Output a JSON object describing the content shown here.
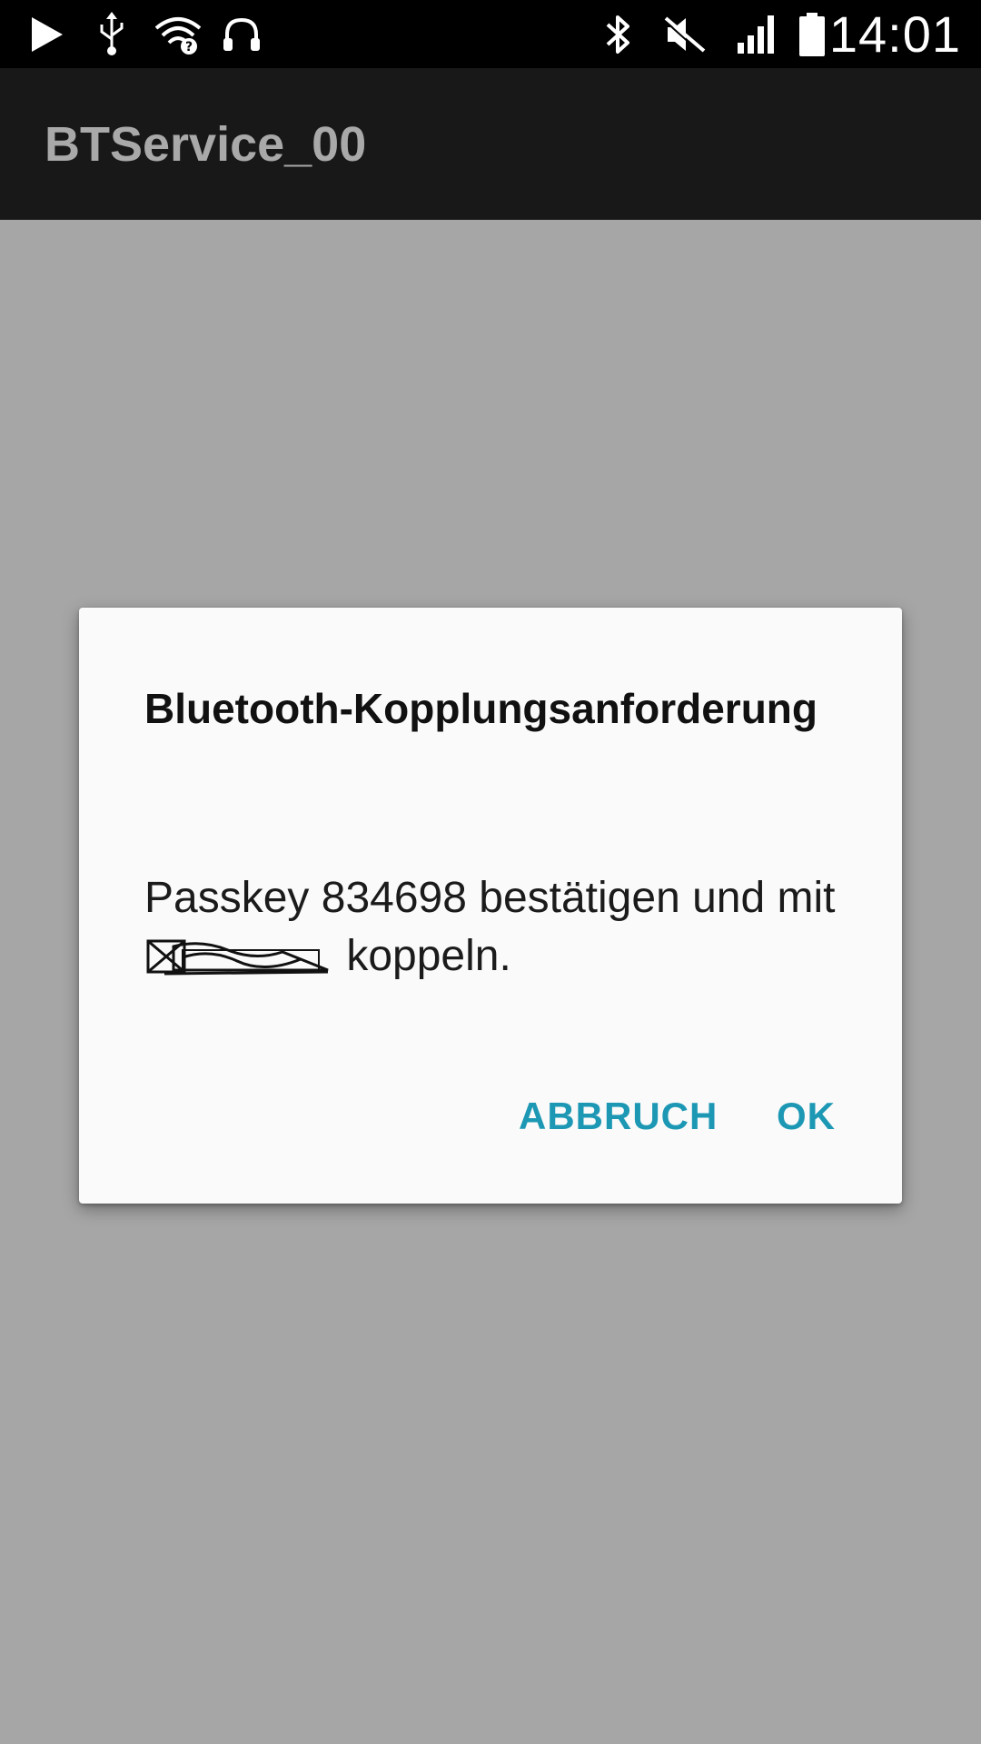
{
  "status_bar": {
    "time": "14:01",
    "icons_left": [
      "play-icon",
      "usb-icon",
      "wifi-question-icon",
      "headphones-icon"
    ],
    "icons_right": [
      "bluetooth-icon",
      "mute-icon",
      "signal-icon",
      "battery-icon"
    ]
  },
  "app_bar": {
    "title": "BTService_00"
  },
  "dialog": {
    "title": "Bluetooth-Kopplungsanforderung",
    "message_prefix": "Passkey 834698 bestätigen und mit",
    "message_suffix": "koppeln.",
    "cancel_label": "ABBRUCH",
    "ok_label": "OK"
  },
  "colors": {
    "status_bar_bg": "#000000",
    "app_bar_bg": "#181818",
    "scrim": "#a6a6a6",
    "dialog_bg": "#fafafa",
    "accent": "#1d98b4"
  }
}
